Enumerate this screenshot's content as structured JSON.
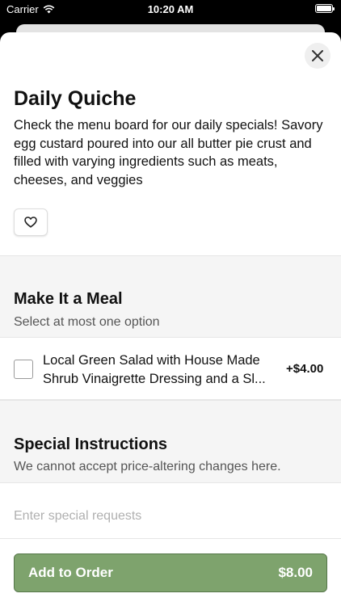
{
  "status_bar": {
    "carrier": "Carrier",
    "time": "10:20 AM",
    "icons": [
      "wifi-icon",
      "battery-icon"
    ]
  },
  "item": {
    "title": "Daily Quiche",
    "description": "Check the menu board for our daily specials! Savory egg custard poured into our all butter pie crust and filled with varying ingredients such as meats, cheeses, and veggies",
    "favorite_icon": "heart-outline-icon",
    "close_icon": "close-icon"
  },
  "meal_section": {
    "title": "Make It a Meal",
    "subtitle": "Select at most one option",
    "options": [
      {
        "label": "Local Green Salad with House Made Shrub Vinaigrette Dressing and a Sl...",
        "price": "+$4.00",
        "checked": false
      }
    ]
  },
  "special_section": {
    "title": "Special Instructions",
    "subtitle": "We cannot accept price-altering changes here.",
    "input_placeholder": "Enter special requests",
    "input_value": ""
  },
  "footer": {
    "add_label": "Add to Order",
    "total": "$8.00",
    "button_color": "#7ea36d"
  }
}
